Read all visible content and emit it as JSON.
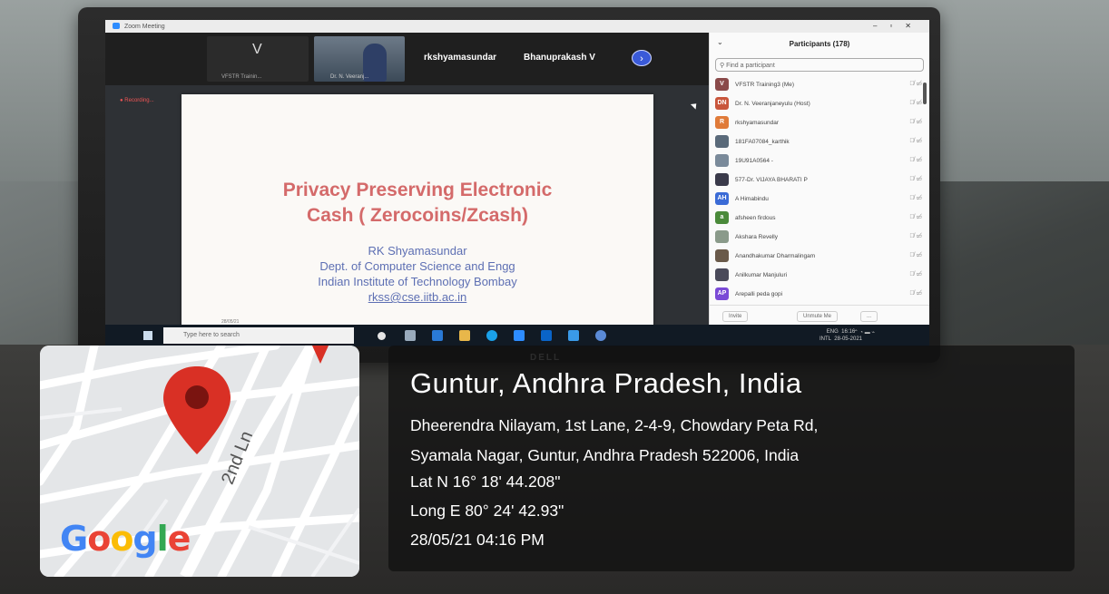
{
  "zoom": {
    "window_title": "Zoom Meeting",
    "recording_label": "Recording...",
    "gallery": {
      "tile1_letter": "V",
      "tile1_caption": "VFSTR Trainin...",
      "tile2_caption": "Dr. N. Veeranj...",
      "name3": "rkshyamasundar",
      "name4": "Bhanuprakash V",
      "next_icon": "chevron-right-icon"
    },
    "slide": {
      "title_line1": "Privacy Preserving Electronic",
      "title_line2": "Cash ( Zerocoins/Zcash)",
      "author": "RK Shyamasundar",
      "department": "Dept. of Computer Science and Engg",
      "institute": "Indian Institute of Technology Bombay",
      "email": "rkss@cse.iitb.ac.in",
      "date": "28/05/21"
    },
    "participants": {
      "header": "Participants (178)",
      "search_placeholder": "Find a participant",
      "items": [
        {
          "initials": "V",
          "name": "VFSTR Training3 (Me)",
          "color": "#8a4a4a"
        },
        {
          "initials": "DN",
          "name": "Dr. N. Veeranjaneyulu (Host)",
          "color": "#c9563c"
        },
        {
          "initials": "R",
          "name": "rkshyamasundar",
          "color": "#e07b39"
        },
        {
          "initials": "",
          "name": "181FA07084_karthik",
          "color": "#5a6a7a"
        },
        {
          "initials": "",
          "name": "19U91A0564 -",
          "color": "#7a8a9a"
        },
        {
          "initials": "",
          "name": "577-Dr. VIJAYA BHARATI P",
          "color": "#3a3a4a"
        },
        {
          "initials": "AH",
          "name": "A Himabindu",
          "color": "#3b6bd6"
        },
        {
          "initials": "a",
          "name": "afsheen firdous",
          "color": "#4a8a3a"
        },
        {
          "initials": "",
          "name": "Akshara Revelly",
          "color": "#8a9a8a"
        },
        {
          "initials": "",
          "name": "Anandhakumar Dharmalingam",
          "color": "#6a5a4a"
        },
        {
          "initials": "",
          "name": "Anilkumar Manjuluri",
          "color": "#4a4a5a"
        },
        {
          "initials": "AP",
          "name": "Arepalli peda gopi",
          "color": "#7a4ad6"
        }
      ],
      "invite_label": "Invite",
      "unmute_label": "Unmute Me",
      "more_label": "..."
    },
    "taskbar": {
      "search_placeholder": "Type here to search",
      "lang": "ENG",
      "lang_sub": "INTL",
      "time": "16:16",
      "date": "28-05-2021"
    }
  },
  "map": {
    "street_label": "2nd Ln",
    "logo": [
      "G",
      "o",
      "o",
      "g",
      "l",
      "e"
    ],
    "pin_color": "#d93025"
  },
  "location": {
    "city": "Guntur, Andhra Pradesh, India",
    "address_line1": "Dheerendra Nilayam, 1st Lane, 2-4-9, Chowdary Peta Rd,",
    "address_line2": "Syamala Nagar, Guntur, Andhra Pradesh 522006, India",
    "latitude": "Lat N 16° 18' 44.208\"",
    "longitude": "Long E 80° 24' 42.93\"",
    "timestamp": "28/05/21 04:16 PM"
  }
}
